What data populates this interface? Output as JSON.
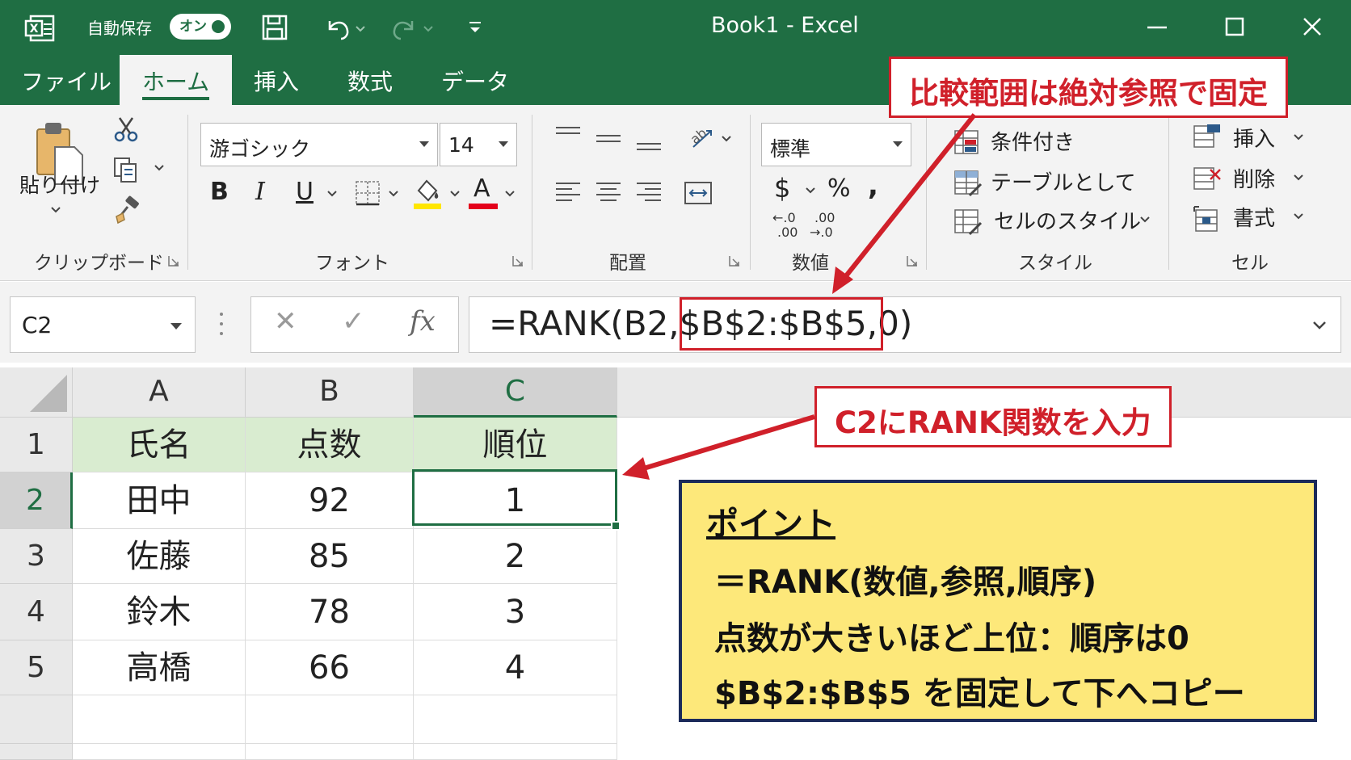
{
  "titlebar": {
    "autosave_label": "自動保存",
    "autosave_state": "オン",
    "title": "Book1  -  Excel",
    "icons": [
      "excel-icon",
      "save-icon",
      "undo-icon",
      "redo-icon",
      "customize-icon",
      "minimize-icon",
      "maximize-icon",
      "close-icon"
    ]
  },
  "tabs": [
    {
      "label": "ファイル",
      "active": false
    },
    {
      "label": "ホーム",
      "active": true
    },
    {
      "label": "挿入",
      "active": false
    },
    {
      "label": "数式",
      "active": false
    },
    {
      "label": "データ",
      "active": false
    }
  ],
  "ribbon": {
    "clipboard": {
      "paste_label": "貼り付け",
      "group_label": "クリップボード"
    },
    "font": {
      "font_name": "游ゴシック",
      "font_size": "14",
      "bold": "B",
      "italic": "I",
      "underline": "U",
      "font_color_glyph": "A",
      "group_label": "フォント"
    },
    "alignment": {
      "group_label": "配置"
    },
    "number": {
      "format": "標準",
      "currency": "$",
      "percent": "%",
      "comma": ",",
      "inc_decimal_top": "←.0",
      "inc_decimal_bottom": ".00",
      "dec_decimal_top": ".00",
      "dec_decimal_bottom": "→.0",
      "group_label": "数値"
    },
    "styles": {
      "conditional": "条件付き",
      "table": "テーブルとして",
      "cell_style": "セルのスタイル",
      "group_label": "スタイル"
    },
    "cells": {
      "insert": "挿入",
      "delete": "削除",
      "format": "書式",
      "group_label": "セル"
    }
  },
  "formula_bar": {
    "name_box": "C2",
    "cancel": "✕",
    "enter": "✓",
    "fx": "fx",
    "formula_prefix": "=RANK(B2,",
    "formula_range": "$B$2:$B$5",
    "formula_suffix": ",0)"
  },
  "grid": {
    "columns": [
      "A",
      "B",
      "C"
    ],
    "rows": [
      "1",
      "2",
      "3",
      "4",
      "5"
    ],
    "header": [
      "氏名",
      "点数",
      "順位"
    ],
    "data": [
      [
        "田中",
        "92",
        "1"
      ],
      [
        "佐藤",
        "85",
        "2"
      ],
      [
        "鈴木",
        "78",
        "3"
      ],
      [
        "高橋",
        "66",
        "4"
      ]
    ]
  },
  "colors": {
    "excel_green": "#1f6e43",
    "callout_red": "#d0202a",
    "header_fill": "#d9ecd0",
    "point_fill": "#fde87a",
    "point_border": "#1b2a5a"
  },
  "annotations": {
    "callout_fixed": "比較範囲は絶対参照で固定",
    "callout_input": "C2にRANK関数を入力",
    "point_title": "ポイント",
    "point_lines": [
      "＝RANK(数値,参照,順序)",
      "点数が大きいほど上位：順序は0",
      "$B$2:$B$5 を固定して下へコピー"
    ]
  }
}
